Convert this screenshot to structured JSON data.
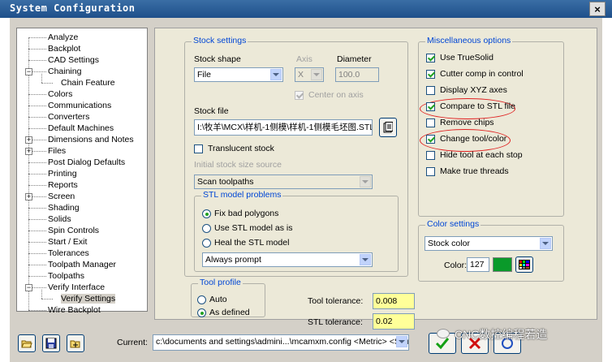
{
  "window": {
    "title": "System Configuration",
    "close_glyph": "×"
  },
  "tree": {
    "items": [
      {
        "label": "Analyze"
      },
      {
        "label": "Backplot"
      },
      {
        "label": "CAD Settings"
      },
      {
        "label": "Chaining"
      },
      {
        "label": "Chain Feature"
      },
      {
        "label": "Colors"
      },
      {
        "label": "Communications"
      },
      {
        "label": "Converters"
      },
      {
        "label": "Default Machines"
      },
      {
        "label": "Dimensions and Notes"
      },
      {
        "label": "Files"
      },
      {
        "label": "Post Dialog Defaults"
      },
      {
        "label": "Printing"
      },
      {
        "label": "Reports"
      },
      {
        "label": "Screen"
      },
      {
        "label": "Shading"
      },
      {
        "label": "Solids"
      },
      {
        "label": "Spin Controls"
      },
      {
        "label": "Start / Exit"
      },
      {
        "label": "Tolerances"
      },
      {
        "label": "Toolpath Manager"
      },
      {
        "label": "Toolpaths"
      },
      {
        "label": "Verify Interface"
      },
      {
        "label": "Verify Settings"
      },
      {
        "label": "Wire Backplot"
      }
    ],
    "selected": "Verify Settings"
  },
  "stock_settings": {
    "title": "Stock settings",
    "shape_label": "Stock shape",
    "shape_value": "File",
    "axis_label": "Axis",
    "axis_value": "X",
    "diameter_label": "Diameter",
    "diameter_value": "100.0",
    "center_on_axis": "Center on axis",
    "file_label": "Stock file",
    "file_value": "I:\\牧羊\\MCX\\样机-1侧模\\样机-1侧模毛坯图.STL",
    "translucent": "Translucent stock",
    "initial_size_label": "Initial stock size source",
    "initial_size_value": "Scan toolpaths"
  },
  "stl_problems": {
    "title": "STL model problems",
    "options": [
      "Fix bad polygons",
      "Use STL model as is",
      "Heal the STL model"
    ],
    "selected_index": 0,
    "prompt_value": "Always prompt"
  },
  "tool_profile": {
    "title": "Tool profile",
    "options": [
      "Auto",
      "As defined"
    ],
    "selected_index": 1
  },
  "tolerances": {
    "tool_label": "Tool tolerance:",
    "tool_value": "0.008",
    "stl_label": "STL tolerance:",
    "stl_value": "0.02"
  },
  "misc": {
    "title": "Miscellaneous options",
    "options": [
      {
        "label": "Use TrueSolid",
        "checked": true
      },
      {
        "label": "Cutter comp in control",
        "checked": true
      },
      {
        "label": "Display XYZ axes",
        "checked": false
      },
      {
        "label": "Compare to STL file",
        "checked": true
      },
      {
        "label": "Remove chips",
        "checked": false
      },
      {
        "label": "Change tool/color",
        "checked": true
      },
      {
        "label": "Hide tool at each stop",
        "checked": false
      },
      {
        "label": "Make true threads",
        "checked": false
      }
    ]
  },
  "color_settings": {
    "title": "Color settings",
    "combo_value": "Stock color",
    "color_label": "Color:",
    "color_value": "127",
    "swatch_color": "#0a9a2a"
  },
  "bottom": {
    "current_label": "Current:",
    "current_value": "c:\\documents and settings\\admini...\\mcamxm.config <Metric> <Startup>"
  },
  "watermark": {
    "text": "CNC数控编程若造"
  }
}
